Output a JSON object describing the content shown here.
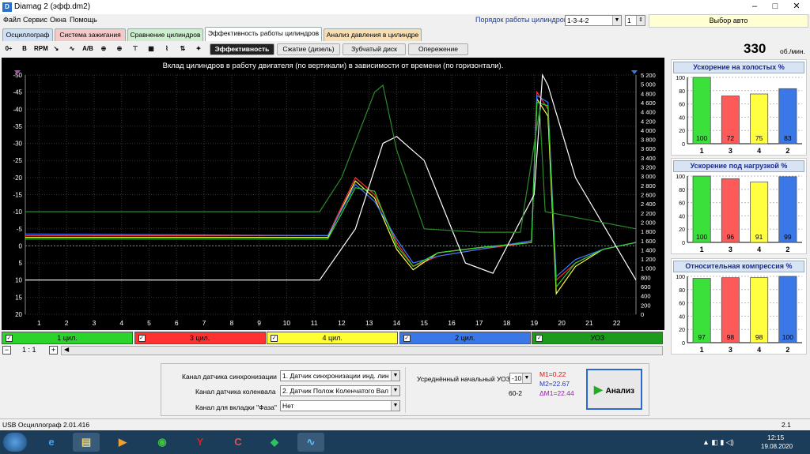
{
  "window": {
    "title": "Diamag 2 (эфф.dm2)",
    "minimize": "–",
    "maximize": "□",
    "close": "✕"
  },
  "menu": [
    "Файл",
    "Сервис",
    "Окна",
    "Помощь"
  ],
  "tabs": [
    {
      "label": "Осциллограф",
      "color": "#cfe0f5"
    },
    {
      "label": "Система зажигания",
      "color": "#f6c9c9"
    },
    {
      "label": "Сравнение цилиндров",
      "color": "#cdeecd"
    },
    {
      "label": "Эффективность работы цилиндров",
      "color": "#ffffff"
    },
    {
      "label": "Анализ давления в цилиндре",
      "color": "#f7dfb3"
    }
  ],
  "cylinder_order": {
    "label": "Порядок работы цилиндров",
    "value": "1-3-4-2",
    "cylinder": "1"
  },
  "auto_select": "Выбор авто",
  "subtabs": [
    "Эффективность",
    "Сжатие (дизель)",
    "Зубчатый диск",
    "Опережение"
  ],
  "rpm": {
    "value": "330",
    "unit": "об./мин."
  },
  "toolbar_icons": [
    "0÷",
    "B",
    "RPM",
    "↘",
    "∿",
    "A/B",
    "⊕",
    "⊕",
    "⊤",
    "▦",
    "⌇",
    "⇅",
    "✦"
  ],
  "chart_data": {
    "type": "line",
    "title": "Вклад цилиндров в работу двигателя (по вертикали) в зависимости от времени (по горизонтали).",
    "x_ticks": [
      "1",
      "2",
      "3",
      "4",
      "5",
      "6",
      "7",
      "8",
      "9",
      "10",
      "11",
      "12",
      "13",
      "14",
      "15",
      "16",
      "17",
      "18",
      "19",
      "20",
      "21",
      "22"
    ],
    "y_left_ticks": [
      "-50",
      "-45",
      "-40",
      "-35",
      "-30",
      "-25",
      "-20",
      "-15",
      "-10",
      "-5",
      "0",
      "5",
      "10",
      "15",
      "20"
    ],
    "y_right_ticks": [
      "5 200",
      "5 000",
      "4 800",
      "4 600",
      "4 400",
      "4 200",
      "4 000",
      "3 800",
      "3 600",
      "3 400",
      "3 200",
      "3 000",
      "2 800",
      "2 600",
      "2 400",
      "2 200",
      "2 000",
      "1 800",
      "1 600",
      "1 400",
      "1 200",
      "1 000",
      "800",
      "600",
      "400",
      "200",
      "0"
    ],
    "ylim_left": [
      -50,
      20
    ],
    "ylim_right": [
      0,
      5200
    ],
    "xlim": [
      0.5,
      22.7
    ],
    "series": [
      {
        "color": "#ff3030",
        "x": [
          0.5,
          11.5,
          12.5,
          13.2,
          14,
          14.6,
          15.5,
          17,
          18.9,
          19.1,
          19.5,
          19.8,
          20.5,
          21.5,
          22.7
        ],
        "y": [
          -3,
          -3,
          -20,
          -15,
          -1,
          6,
          3,
          1,
          -1,
          -45,
          -40,
          10,
          5,
          1,
          -1
        ]
      },
      {
        "color": "#ffff40",
        "x": [
          0.5,
          11.5,
          12.5,
          13.2,
          14,
          14.6,
          15.5,
          17,
          18.9,
          19.1,
          19.5,
          19.8,
          20.5,
          21.5,
          22.7
        ],
        "y": [
          -2.5,
          -2.5,
          -19,
          -14,
          1,
          7,
          2,
          0.5,
          -1,
          -43,
          -38,
          14,
          6,
          1,
          -1
        ]
      },
      {
        "color": "#3a7aff",
        "x": [
          0.5,
          11.5,
          12.5,
          13.2,
          14,
          14.6,
          15.5,
          17,
          18.9,
          19.1,
          19.5,
          19.8,
          20.5,
          21.5,
          22.7
        ],
        "y": [
          -3.5,
          -3,
          -18,
          -13,
          -2,
          5,
          3,
          1,
          -1.5,
          -44,
          -42,
          9,
          4,
          1,
          -1
        ]
      },
      {
        "color": "#30d030",
        "x": [
          0.5,
          11.5,
          12.5,
          13.2,
          14,
          14.6,
          15.5,
          17,
          18.9,
          19.1,
          19.5,
          19.8,
          20.5,
          21.5,
          22.7
        ],
        "y": [
          -2,
          -2,
          -17,
          -16,
          0,
          6,
          2,
          0.5,
          -1,
          -42,
          -41,
          12,
          5,
          1,
          -1
        ]
      },
      {
        "color": "#ffffff",
        "x": [
          0.5,
          11.2,
          12.5,
          13.5,
          14,
          15,
          16.5,
          17.5,
          19,
          19.3,
          19.5,
          20.5,
          22.7
        ],
        "y": [
          10,
          10,
          -5,
          -30,
          -32,
          -25,
          5,
          8,
          -15,
          -50,
          -47,
          -20,
          10
        ]
      },
      {
        "color": "#2c8a2c",
        "x": [
          0.5,
          11.2,
          12,
          13.2,
          13.5,
          14,
          15,
          17,
          18.5,
          19.2,
          19.4,
          22.7
        ],
        "y": [
          -10,
          -10,
          -20,
          -45,
          -47,
          -28,
          -5,
          -4,
          -4,
          -40,
          -10,
          -5
        ]
      }
    ]
  },
  "channels": [
    {
      "label": "1 цил.",
      "color": "#2bd42b"
    },
    {
      "label": "3 цил.",
      "color": "#ff3232"
    },
    {
      "label": "4 цил.",
      "color": "#ffff32"
    },
    {
      "label": "2 цил.",
      "color": "#3a78e8"
    },
    {
      "label": "УОЗ",
      "color": "#1c9a1c"
    }
  ],
  "zoom": "1 : 1",
  "panels": [
    {
      "title": "Ускорение на холостых %",
      "cylinders": [
        "1",
        "3",
        "4",
        "2"
      ],
      "values": [
        100,
        72,
        75,
        83
      ],
      "labels": [
        "100",
        "72",
        "75",
        "83"
      ]
    },
    {
      "title": "Ускорение под нагрузкой %",
      "cylinders": [
        "1",
        "3",
        "4",
        "2"
      ],
      "values": [
        100,
        96,
        91,
        99
      ],
      "labels": [
        "100",
        "96",
        "91",
        "99"
      ]
    },
    {
      "title": "Относительная компрессия %",
      "cylinders": [
        "1",
        "3",
        "4",
        "2"
      ],
      "values": [
        97,
        98,
        98,
        100
      ],
      "labels": [
        "97",
        "98",
        "98",
        "100"
      ]
    }
  ],
  "panel_y_ticks": [
    "100",
    "80",
    "60",
    "40",
    "20",
    "0"
  ],
  "bar_colors": [
    "#3be03b",
    "#ff5a5a",
    "#ffff40",
    "#3a78e8"
  ],
  "settings": {
    "sync_label": "Канал датчика синхронизации",
    "sync_value": "1. Датчик синхронизации инд. лин",
    "crank_label": "Канал датчика коленвала",
    "crank_value": "2. Датчик Полож Коленчатого Вал",
    "phase_label": "Канал для вкладки \"Фаза\"",
    "phase_value": "Нет",
    "uoz_label": "Усреднённый начальный УОЗ",
    "uoz_value": "-10",
    "wheel": "60-2",
    "m1": "M1=0.22",
    "m2": "M2=22.67",
    "dm1": "ΔM1=22.44"
  },
  "analyze": "Анализ",
  "status": {
    "left": "USB Осциллограф  2.01.416",
    "right": "2.1"
  },
  "clock": {
    "time": "12:15",
    "date": "19.08.2020"
  }
}
